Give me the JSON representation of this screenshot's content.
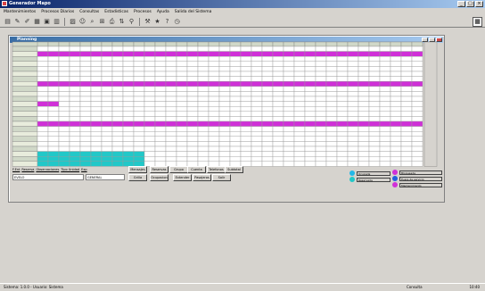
{
  "window": {
    "title": "Generador Mapo"
  },
  "menu": [
    "Mantenimientos",
    "Procesos Diarios",
    "Consultas",
    "Estadisticas",
    "Procesos",
    "Ayuda",
    "Salida del Sistema"
  ],
  "toolbar_icons": [
    "folder-icon",
    "edit-icon",
    "pencil-icon",
    "calendar-icon",
    "grid-icon",
    "table-icon",
    "chart-icon",
    "user-icon",
    "search-icon",
    "tag-icon",
    "print-icon",
    "sort-icon",
    "filter-icon",
    "tool-icon",
    "star-icon",
    "help-icon",
    "clock-icon"
  ],
  "planning": {
    "title": "Planning",
    "header_left": [
      "Hab",
      "Tipo"
    ],
    "room_count": 24,
    "day_count": 36,
    "tabs": [
      "F.Ent",
      "Reserva",
      "Observaciones",
      "Tipo Unidad",
      "Exp"
    ],
    "fields": {
      "client": "EVELO",
      "group": "GENERAL"
    },
    "buttons_row1": [
      "Mensajes",
      "Reservas",
      "Grupo",
      "Cuenta",
      "Telefonos",
      "Subtotal"
    ],
    "buttons_row2": [
      "Grilla",
      "Ocupacion",
      "Extender",
      "Pasajeros",
      "Salir"
    ],
    "legend": [
      {
        "color": "#22b8e8",
        "label": "Ocupada"
      },
      {
        "color": "#22c8c8",
        "label": "Reservada"
      },
      {
        "color": "#d030d8",
        "label": "Bloqueada"
      },
      {
        "color": "#2060e0",
        "label": "Fuera de servicio"
      },
      {
        "color": "#d030d8",
        "label": "Mantenimiento"
      }
    ]
  },
  "colors": {
    "magenta": "#d030d8",
    "cyan": "#22c8c8",
    "white": "#ffffff",
    "header": "#d0d8c8"
  },
  "status": {
    "left": "Sistema: 1.0.0 - Usuario: Sistema",
    "right": "Consulta",
    "clock": "10:40"
  }
}
